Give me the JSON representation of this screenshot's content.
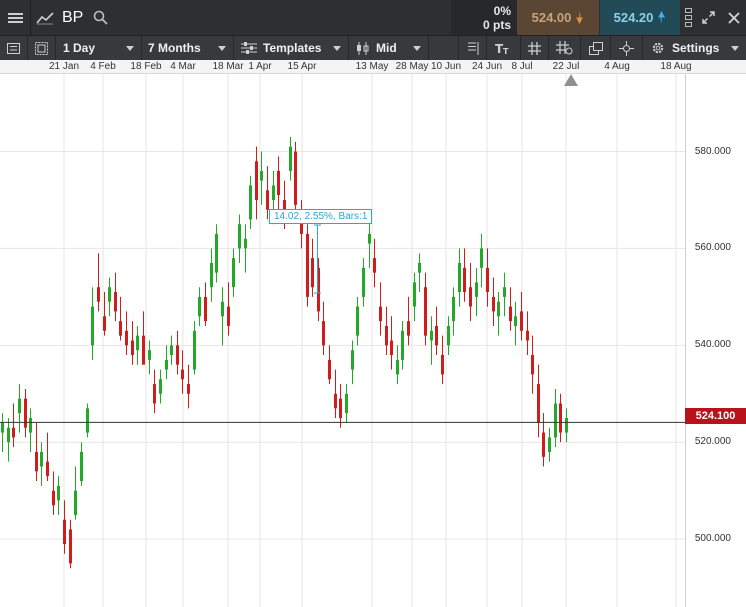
{
  "topbar": {
    "symbol": "BP",
    "change_percent": "0%",
    "change_points": "0 pts",
    "sell_price": "524.00",
    "buy_price": "524.20"
  },
  "toolbar": {
    "interval": "1 Day",
    "range": "7 Months",
    "templates": "Templates",
    "price_type": "Mid",
    "settings": "Settings"
  },
  "measure_label": "14.02, 2.55%, Bars:1",
  "current_price_label": "524.100",
  "chart_data": {
    "type": "candlestick",
    "current_price": 524.1,
    "x_tick_labels": [
      "21 Jan",
      "4 Feb",
      "18 Feb",
      "4 Mar",
      "18 Mar",
      "1 Apr",
      "15 Apr",
      "13 May",
      "28 May",
      "10 Jun",
      "24 Jun",
      "8 Jul",
      "22 Jul",
      "4 Aug",
      "18 Aug"
    ],
    "y_tick_labels": [
      "580.000",
      "560.000",
      "540.000",
      "520.000",
      "500.000"
    ],
    "ylim": [
      486,
      596
    ],
    "grid": true,
    "candles": [
      {
        "o": 522,
        "h": 526,
        "l": 518,
        "c": 524
      },
      {
        "o": 520,
        "h": 525,
        "l": 516,
        "c": 523
      },
      {
        "o": 523,
        "h": 528,
        "l": 519,
        "c": 521
      },
      {
        "o": 526,
        "h": 532,
        "l": 522,
        "c": 529
      },
      {
        "o": 529,
        "h": 531,
        "l": 521,
        "c": 523
      },
      {
        "o": 522,
        "h": 527,
        "l": 518,
        "c": 525
      },
      {
        "o": 518,
        "h": 524,
        "l": 512,
        "c": 514
      },
      {
        "o": 515,
        "h": 520,
        "l": 511,
        "c": 518
      },
      {
        "o": 516,
        "h": 522,
        "l": 512,
        "c": 513
      },
      {
        "o": 510,
        "h": 514,
        "l": 505,
        "c": 507
      },
      {
        "o": 508,
        "h": 513,
        "l": 505,
        "c": 511
      },
      {
        "o": 504,
        "h": 508,
        "l": 497,
        "c": 499
      },
      {
        "o": 502,
        "h": 504,
        "l": 494,
        "c": 495
      },
      {
        "o": 505,
        "h": 515,
        "l": 504,
        "c": 510
      },
      {
        "o": 512,
        "h": 520,
        "l": 511,
        "c": 518
      },
      {
        "o": 522,
        "h": 528,
        "l": 521,
        "c": 527
      },
      {
        "o": 540,
        "h": 552,
        "l": 537,
        "c": 548
      },
      {
        "o": 552,
        "h": 559,
        "l": 547,
        "c": 549
      },
      {
        "o": 546,
        "h": 551,
        "l": 542,
        "c": 543
      },
      {
        "o": 549,
        "h": 554,
        "l": 546,
        "c": 552
      },
      {
        "o": 551,
        "h": 555,
        "l": 545,
        "c": 547
      },
      {
        "o": 545,
        "h": 550,
        "l": 541,
        "c": 542
      },
      {
        "o": 543,
        "h": 547,
        "l": 538,
        "c": 540
      },
      {
        "o": 541,
        "h": 545,
        "l": 536,
        "c": 538
      },
      {
        "o": 539,
        "h": 544,
        "l": 536,
        "c": 542
      },
      {
        "o": 542,
        "h": 547,
        "l": 540,
        "c": 536
      },
      {
        "o": 537,
        "h": 541,
        "l": 534,
        "c": 539
      },
      {
        "o": 532,
        "h": 535,
        "l": 526,
        "c": 528
      },
      {
        "o": 530,
        "h": 535,
        "l": 528,
        "c": 533
      },
      {
        "o": 535,
        "h": 540,
        "l": 533,
        "c": 537
      },
      {
        "o": 538,
        "h": 542,
        "l": 536,
        "c": 540
      },
      {
        "o": 540,
        "h": 543,
        "l": 534,
        "c": 536
      },
      {
        "o": 535,
        "h": 539,
        "l": 530,
        "c": 533
      },
      {
        "o": 532,
        "h": 536,
        "l": 527,
        "c": 530
      },
      {
        "o": 535,
        "h": 545,
        "l": 534,
        "c": 543
      },
      {
        "o": 546,
        "h": 552,
        "l": 544,
        "c": 550
      },
      {
        "o": 550,
        "h": 553,
        "l": 544,
        "c": 545
      },
      {
        "o": 552,
        "h": 560,
        "l": 549,
        "c": 557
      },
      {
        "o": 555,
        "h": 565,
        "l": 553,
        "c": 563
      },
      {
        "o": 546,
        "h": 552,
        "l": 540,
        "c": 549
      },
      {
        "o": 548,
        "h": 553,
        "l": 542,
        "c": 544
      },
      {
        "o": 552,
        "h": 560,
        "l": 550,
        "c": 558
      },
      {
        "o": 560,
        "h": 567,
        "l": 557,
        "c": 565
      },
      {
        "o": 560,
        "h": 565,
        "l": 555,
        "c": 562
      },
      {
        "o": 566,
        "h": 575,
        "l": 564,
        "c": 573
      },
      {
        "o": 578,
        "h": 581,
        "l": 566,
        "c": 570
      },
      {
        "o": 574,
        "h": 580,
        "l": 569,
        "c": 576
      },
      {
        "o": 572,
        "h": 577,
        "l": 566,
        "c": 568
      },
      {
        "o": 570,
        "h": 576,
        "l": 565,
        "c": 573
      },
      {
        "o": 576,
        "h": 579,
        "l": 568,
        "c": 571
      },
      {
        "o": 570,
        "h": 574,
        "l": 564,
        "c": 567
      },
      {
        "o": 576,
        "h": 583,
        "l": 574,
        "c": 581
      },
      {
        "o": 580,
        "h": 582,
        "l": 566,
        "c": 569
      },
      {
        "o": 567,
        "h": 570,
        "l": 560,
        "c": 563
      },
      {
        "o": 563,
        "h": 565,
        "l": 548,
        "c": 550
      },
      {
        "o": 558,
        "h": 562,
        "l": 550,
        "c": 552
      },
      {
        "o": 556,
        "h": 558,
        "l": 545,
        "c": 547
      },
      {
        "o": 545,
        "h": 549,
        "l": 538,
        "c": 540
      },
      {
        "o": 537,
        "h": 540,
        "l": 532,
        "c": 533
      },
      {
        "o": 530,
        "h": 535,
        "l": 525,
        "c": 527
      },
      {
        "o": 529,
        "h": 532,
        "l": 523,
        "c": 525
      },
      {
        "o": 526,
        "h": 532,
        "l": 524,
        "c": 530
      },
      {
        "o": 535,
        "h": 541,
        "l": 532,
        "c": 539
      },
      {
        "o": 542,
        "h": 550,
        "l": 540,
        "c": 548
      },
      {
        "o": 550,
        "h": 558,
        "l": 548,
        "c": 556
      },
      {
        "o": 561,
        "h": 565,
        "l": 556,
        "c": 563
      },
      {
        "o": 558,
        "h": 562,
        "l": 552,
        "c": 555
      },
      {
        "o": 548,
        "h": 553,
        "l": 542,
        "c": 545
      },
      {
        "o": 544,
        "h": 548,
        "l": 538,
        "c": 540
      },
      {
        "o": 541,
        "h": 546,
        "l": 535,
        "c": 538
      },
      {
        "o": 534,
        "h": 540,
        "l": 532,
        "c": 537
      },
      {
        "o": 537,
        "h": 545,
        "l": 535,
        "c": 543
      },
      {
        "o": 545,
        "h": 550,
        "l": 540,
        "c": 542
      },
      {
        "o": 548,
        "h": 555,
        "l": 545,
        "c": 553
      },
      {
        "o": 555,
        "h": 559,
        "l": 551,
        "c": 557
      },
      {
        "o": 552,
        "h": 555,
        "l": 540,
        "c": 542
      },
      {
        "o": 541,
        "h": 546,
        "l": 536,
        "c": 543
      },
      {
        "o": 544,
        "h": 548,
        "l": 538,
        "c": 540
      },
      {
        "o": 538,
        "h": 542,
        "l": 532,
        "c": 534
      },
      {
        "o": 540,
        "h": 546,
        "l": 538,
        "c": 544
      },
      {
        "o": 545,
        "h": 552,
        "l": 542,
        "c": 550
      },
      {
        "o": 551,
        "h": 560,
        "l": 548,
        "c": 557
      },
      {
        "o": 556,
        "h": 560,
        "l": 549,
        "c": 551
      },
      {
        "o": 552,
        "h": 557,
        "l": 545,
        "c": 548
      },
      {
        "o": 550,
        "h": 556,
        "l": 546,
        "c": 553
      },
      {
        "o": 556,
        "h": 563,
        "l": 552,
        "c": 560
      },
      {
        "o": 556,
        "h": 560,
        "l": 548,
        "c": 551
      },
      {
        "o": 550,
        "h": 554,
        "l": 544,
        "c": 547
      },
      {
        "o": 546,
        "h": 551,
        "l": 542,
        "c": 549
      },
      {
        "o": 550,
        "h": 555,
        "l": 546,
        "c": 552
      },
      {
        "o": 548,
        "h": 552,
        "l": 543,
        "c": 545
      },
      {
        "o": 544,
        "h": 549,
        "l": 540,
        "c": 546
      },
      {
        "o": 547,
        "h": 551,
        "l": 541,
        "c": 543
      },
      {
        "o": 543,
        "h": 547,
        "l": 538,
        "c": 541
      },
      {
        "o": 538,
        "h": 542,
        "l": 530,
        "c": 534
      },
      {
        "o": 532,
        "h": 536,
        "l": 521,
        "c": 524
      },
      {
        "o": 522,
        "h": 526,
        "l": 515,
        "c": 517
      },
      {
        "o": 518,
        "h": 523,
        "l": 516,
        "c": 521
      },
      {
        "o": 521,
        "h": 531,
        "l": 519,
        "c": 528
      },
      {
        "o": 528,
        "h": 530,
        "l": 520,
        "c": 522
      },
      {
        "o": 522,
        "h": 527,
        "l": 520,
        "c": 525
      }
    ]
  }
}
